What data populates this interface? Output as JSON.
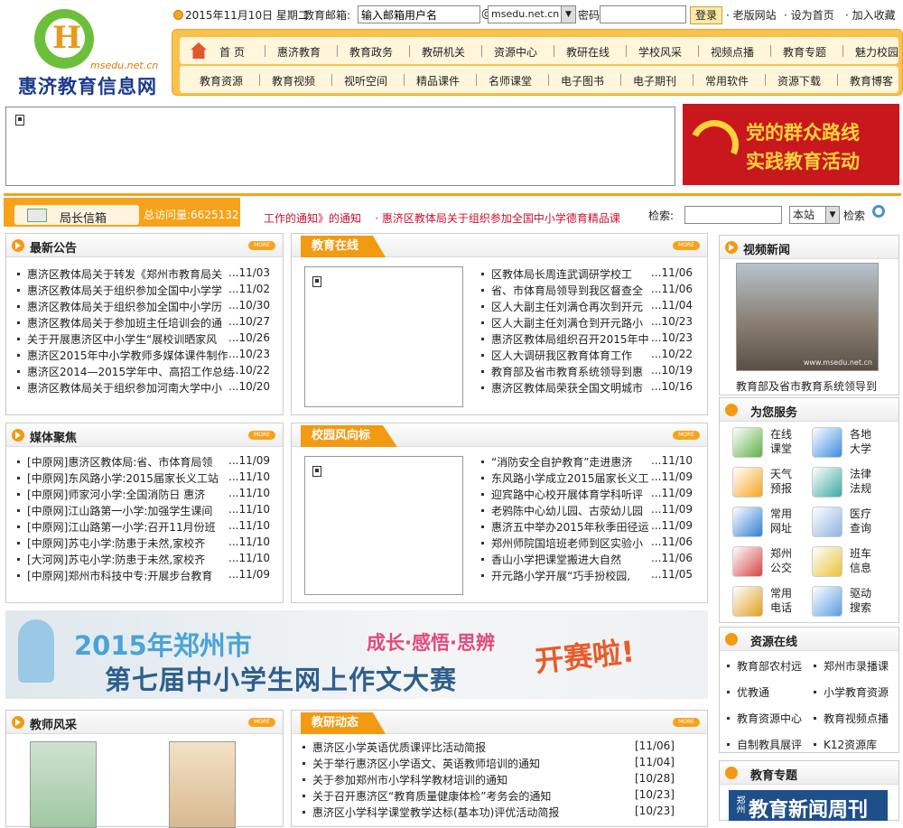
{
  "site": {
    "name": "惠济教育信息网",
    "domain": "msedu.net.cn"
  },
  "topbar": {
    "date": "2015年11月10日",
    "weekday": "星期二",
    "mail_label": "教育邮箱:",
    "mail_placeholder": "输入邮箱用户名",
    "at": "@",
    "mail_domain": "msedu.net.cn",
    "password_label": "密码",
    "login": "登录",
    "old_site": "· 老版网站",
    "set_home": "· 设为首页",
    "favorite": "· 加入收藏"
  },
  "nav": {
    "row1": [
      "首 页",
      "惠济教育",
      "教育政务",
      "教研机关",
      "资源中心",
      "教研在线",
      "学校风采",
      "视频点播",
      "教育专题",
      "魅力校园"
    ],
    "row2": [
      "教育资源",
      "教育视频",
      "视听空间",
      "精品课件",
      "名师课堂",
      "电子图书",
      "电子期刊",
      "常用软件",
      "资源下载",
      "教育博客"
    ]
  },
  "party": {
    "line1": "党的群众路线",
    "line2": "实践教育活动"
  },
  "ticker": {
    "mailbox": "局长信箱",
    "visits": "总访问量:6625132",
    "marquee_a": "工作的通知》的通知",
    "marquee_b": "· 惠济区教体局关于组织参加全国中小学德育精品课",
    "search_label": "检索:",
    "scope": "本站",
    "search_button": "检索"
  },
  "announcements": {
    "title": "最新公告",
    "more": "MORE",
    "items": [
      {
        "text": "惠济区教体局关于转发《郑州市教育局关",
        "date": "...11/03"
      },
      {
        "text": "惠济区教体局关于组织参加全国中小学学",
        "date": "...11/02"
      },
      {
        "text": "惠济区教体局关于组织参加全国中小学历",
        "date": "...10/30"
      },
      {
        "text": "惠济区教体局关于参加班主任培训会的通",
        "date": "...10/27"
      },
      {
        "text": "关于开展惠济区中小学生“展校训晒家风",
        "date": "...10/26"
      },
      {
        "text": "惠济区2015年中小学教师多媒体课件制作",
        "date": "...10/23"
      },
      {
        "text": "惠济区2014—2015学年中、高招工作总结",
        "date": "...10/22"
      },
      {
        "text": "惠济区教体局关于组织参加河南大学中小",
        "date": "...10/20"
      }
    ]
  },
  "edu_online": {
    "title": "教育在线",
    "more": "MORE",
    "items": [
      {
        "text": "区教体局长周连武调研学校工",
        "date": "...11/06"
      },
      {
        "text": "省、市体育局领导到我区督查全",
        "date": "...11/06"
      },
      {
        "text": "区人大副主任刘满仓再次到开元",
        "date": "...11/04"
      },
      {
        "text": "区人大副主任刘满仓到开元路小",
        "date": "...10/23"
      },
      {
        "text": "惠济区教体局组织召开2015年中",
        "date": "...10/23"
      },
      {
        "text": "区人大调研我区教育体育工作",
        "date": "...10/22"
      },
      {
        "text": "教育部及省市教育系统领导到惠",
        "date": "...10/19"
      },
      {
        "text": "惠济区教体局荣获全国文明城市",
        "date": "...10/16"
      }
    ]
  },
  "media": {
    "title": "媒体聚焦",
    "more": "MORE",
    "items": [
      {
        "text": "[中原网]惠济区教体局:省、市体育局领",
        "date": "...11/09"
      },
      {
        "text": "[中原网]东风路小学:2015届家长义工站",
        "date": "...11/10"
      },
      {
        "text": "[中原网]师家河小学:全国消防日 惠济",
        "date": "...11/10"
      },
      {
        "text": "[中原网]江山路第一小学:加强学生课间",
        "date": "...11/10"
      },
      {
        "text": "[中原网]江山路第一小学:召开11月份班",
        "date": "...11/10"
      },
      {
        "text": "[中原网]苏屯小学:防患于未然,家校齐",
        "date": "...11/10"
      },
      {
        "text": "[大河网]苏屯小学:防患于未然,家校齐",
        "date": "...11/10"
      },
      {
        "text": "[中原网]郑州市科技中专:开展步台教育",
        "date": "...11/09"
      }
    ]
  },
  "campus": {
    "title": "校园风向标",
    "more": "MORE",
    "items": [
      {
        "text": "“消防安全自护教育”走进惠济",
        "date": "...11/10"
      },
      {
        "text": "东风路小学成立2015届家长义工",
        "date": "...11/09"
      },
      {
        "text": "迎宾路中心校开展体育学科听评",
        "date": "...11/09"
      },
      {
        "text": "老鸦陈中心幼儿园、古荥幼儿园",
        "date": "...11/09"
      },
      {
        "text": "惠济五中举办2015年秋季田径运",
        "date": "...11/09"
      },
      {
        "text": "郑州师院国培班老师到区实验小",
        "date": "...11/06"
      },
      {
        "text": "香山小学把课堂搬进大自然",
        "date": "...11/06"
      },
      {
        "text": "开元路小学开展“巧手扮校园,",
        "date": "...11/05"
      }
    ]
  },
  "essay_banner": {
    "line1": "2015年郑州市",
    "line2": "第七届中小学生网上作文大赛",
    "slogan": "成长·感悟·思辨",
    "open": "开赛啦!"
  },
  "teachers": {
    "title": "教师风采",
    "more": "MORE"
  },
  "research": {
    "title": "教研动态",
    "more": "MORE",
    "items": [
      {
        "text": "惠济区小学英语优质课评比活动简报",
        "date": "[11/06]"
      },
      {
        "text": "关于举行惠济区小学语文、英语教师培训的通知",
        "date": "[11/04]"
      },
      {
        "text": "关于参加郑州市小学科学教材培训的通知",
        "date": "[10/28]"
      },
      {
        "text": "关于召开惠济区“教育质量健康体检”考务会的通知",
        "date": "[10/23]"
      },
      {
        "text": "惠济区小学科学课堂教学达标(基本功)评优活动简报",
        "date": "[10/23]"
      }
    ]
  },
  "video_news": {
    "title": "视频新闻",
    "caption": "教育部及省市教育系统领导到",
    "watermark": "www.msedu.net.cn"
  },
  "services": {
    "title": "为您服务",
    "items": [
      {
        "l1": "在线",
        "l2": "课堂",
        "icon": "download-icon"
      },
      {
        "l1": "各地",
        "l2": "大学",
        "icon": "folder-icon"
      },
      {
        "l1": "天气",
        "l2": "预报",
        "icon": "sun-icon"
      },
      {
        "l1": "法律",
        "l2": "法规",
        "icon": "law-icon"
      },
      {
        "l1": "常用",
        "l2": "网址",
        "icon": "globe-icon"
      },
      {
        "l1": "医疗",
        "l2": "查询",
        "icon": "medical-icon"
      },
      {
        "l1": "郑州",
        "l2": "公交",
        "icon": "bus-icon"
      },
      {
        "l1": "班车",
        "l2": "信息",
        "icon": "note-icon"
      },
      {
        "l1": "常用",
        "l2": "电话",
        "icon": "phone-icon"
      },
      {
        "l1": "驱动",
        "l2": "搜索",
        "icon": "search-icon"
      }
    ]
  },
  "resources": {
    "title": "资源在线",
    "items": [
      "教育部农村远",
      "郑州市录播课",
      "优教通",
      "小学教育资源",
      "教育资源中心",
      "教育视频点播",
      "自制教具展评",
      "K12资源库"
    ]
  },
  "topics": {
    "title": "教育专题",
    "banner": "教育新闻周刊",
    "banner_prefix": "郑州"
  },
  "colors": {
    "orange": "#f7a21b",
    "nav_bg": "#f8c24b",
    "party_red": "#c8181e",
    "marquee_red": "#c8102e"
  }
}
